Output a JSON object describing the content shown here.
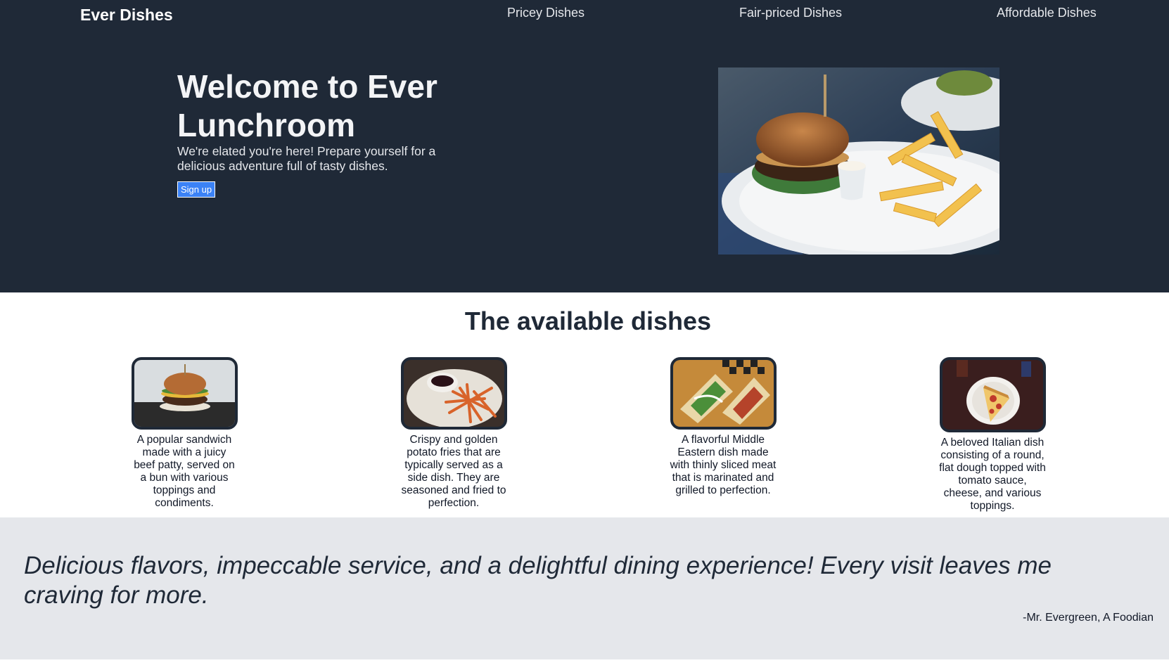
{
  "header": {
    "brand": "Ever Dishes",
    "nav": [
      {
        "label": "Pricey Dishes"
      },
      {
        "label": "Fair-priced Dishes"
      },
      {
        "label": "Affordable Dishes"
      }
    ]
  },
  "hero": {
    "title": "Welcome to Ever Lunchroom",
    "subtitle": "We're elated you're here! Prepare yourself for a delicious adventure full of tasty dishes.",
    "cta_label": "Sign up"
  },
  "dishes": {
    "title": "The available dishes",
    "items": [
      {
        "icon": "burger-photo",
        "description": "A popular sandwich made with a juicy beef patty, served on a bun with various toppings and condiments."
      },
      {
        "icon": "fries-photo",
        "description": "Crispy and golden potato fries that are typically served as a side dish. They are seasoned and fried to perfection."
      },
      {
        "icon": "shawarma-photo",
        "description": "A flavorful Middle Eastern dish made with thinly sliced meat that is marinated and grilled to perfection."
      },
      {
        "icon": "pizza-photo",
        "description": "A beloved Italian dish consisting of a round, flat dough topped with tomato sauce, cheese, and various toppings."
      }
    ]
  },
  "testimonial": {
    "quote": "Delicious flavors, impeccable service, and a delightful dining experience! Every visit leaves me craving for more.",
    "author": "-Mr. Evergreen, A Foodian"
  },
  "colors": {
    "dark": "#1f2937",
    "accent": "#3b82f6",
    "quote_bg": "#e5e7eb"
  }
}
